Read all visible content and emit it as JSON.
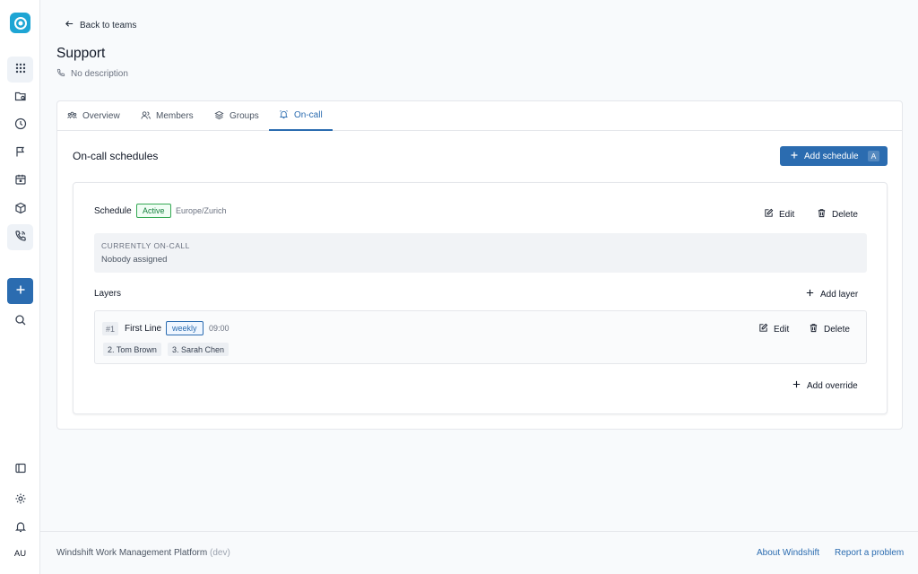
{
  "sidebar": {
    "logo": "windshift-logo",
    "items": [
      {
        "icon": "grid-icon",
        "active": true
      },
      {
        "icon": "folder-search-icon",
        "active": false
      },
      {
        "icon": "clock-icon",
        "active": false
      },
      {
        "icon": "flag-icon",
        "active": false
      },
      {
        "icon": "calendar-icon",
        "active": false
      },
      {
        "icon": "box-icon",
        "active": false
      },
      {
        "icon": "phone-call-icon",
        "active": true
      }
    ],
    "create": {
      "icon": "plus-icon"
    },
    "search": {
      "icon": "search-icon"
    },
    "bottom": [
      {
        "icon": "panel-toggle-icon"
      },
      {
        "icon": "gear-icon"
      },
      {
        "icon": "bell-icon"
      }
    ],
    "avatar_initials": "AU"
  },
  "header": {
    "back_label": "Back to teams",
    "title": "Support",
    "description": "No description"
  },
  "tabs": [
    {
      "label": "Overview",
      "icon": "users-group-icon",
      "active": false
    },
    {
      "label": "Members",
      "icon": "users-icon",
      "active": false
    },
    {
      "label": "Groups",
      "icon": "layers-icon",
      "active": false
    },
    {
      "label": "On-call",
      "icon": "alarm-icon",
      "active": true
    }
  ],
  "oncall": {
    "section_title": "On-call schedules",
    "add_schedule_label": "Add schedule",
    "add_schedule_shortcut": "A",
    "schedule": {
      "label": "Schedule",
      "status": "Active",
      "timezone": "Europe/Zurich",
      "edit_label": "Edit",
      "delete_label": "Delete",
      "currently_caption": "CURRENTLY ON-CALL",
      "currently_value": "Nobody assigned",
      "layers_label": "Layers",
      "add_layer_label": "Add layer",
      "layers": [
        {
          "number": "#1",
          "name": "First Line",
          "frequency": "weekly",
          "time": "09:00",
          "edit_label": "Edit",
          "delete_label": "Delete",
          "members": [
            "2. Tom Brown",
            "3. Sarah Chen"
          ]
        }
      ],
      "add_override_label": "Add override"
    }
  },
  "footer": {
    "platform": "Windshift Work Management Platform",
    "env": "(dev)",
    "about": "About Windshift",
    "report": "Report a problem"
  },
  "colors": {
    "accent": "#2b6cb0",
    "active_green": "#15803d",
    "logo": "#1ea5d4"
  }
}
